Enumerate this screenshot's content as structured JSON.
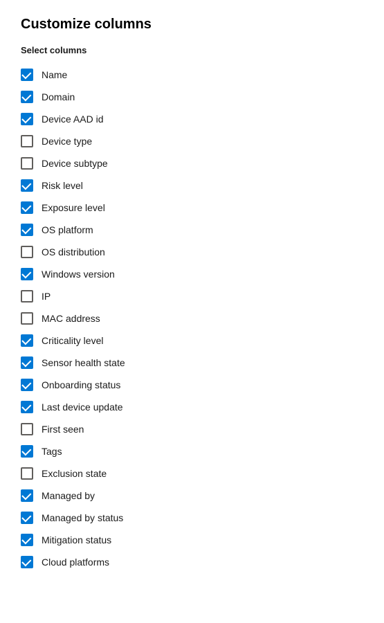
{
  "title": "Customize columns",
  "section_label": "Select columns",
  "columns": [
    {
      "id": "name",
      "label": "Name",
      "checked": true
    },
    {
      "id": "domain",
      "label": "Domain",
      "checked": true
    },
    {
      "id": "device-aad-id",
      "label": "Device AAD id",
      "checked": true
    },
    {
      "id": "device-type",
      "label": "Device type",
      "checked": false
    },
    {
      "id": "device-subtype",
      "label": "Device subtype",
      "checked": false
    },
    {
      "id": "risk-level",
      "label": "Risk level",
      "checked": true
    },
    {
      "id": "exposure-level",
      "label": "Exposure level",
      "checked": true
    },
    {
      "id": "os-platform",
      "label": "OS platform",
      "checked": true
    },
    {
      "id": "os-distribution",
      "label": "OS distribution",
      "checked": false
    },
    {
      "id": "windows-version",
      "label": "Windows version",
      "checked": true
    },
    {
      "id": "ip",
      "label": "IP",
      "checked": false
    },
    {
      "id": "mac-address",
      "label": "MAC address",
      "checked": false
    },
    {
      "id": "criticality-level",
      "label": "Criticality level",
      "checked": true
    },
    {
      "id": "sensor-health-state",
      "label": "Sensor health state",
      "checked": true
    },
    {
      "id": "onboarding-status",
      "label": "Onboarding status",
      "checked": true
    },
    {
      "id": "last-device-update",
      "label": "Last device update",
      "checked": true
    },
    {
      "id": "first-seen",
      "label": "First seen",
      "checked": false
    },
    {
      "id": "tags",
      "label": "Tags",
      "checked": true
    },
    {
      "id": "exclusion-state",
      "label": "Exclusion state",
      "checked": false
    },
    {
      "id": "managed-by",
      "label": "Managed by",
      "checked": true
    },
    {
      "id": "managed-by-status",
      "label": "Managed by status",
      "checked": true
    },
    {
      "id": "mitigation-status",
      "label": "Mitigation status",
      "checked": true
    },
    {
      "id": "cloud-platforms",
      "label": "Cloud platforms",
      "checked": true
    }
  ]
}
